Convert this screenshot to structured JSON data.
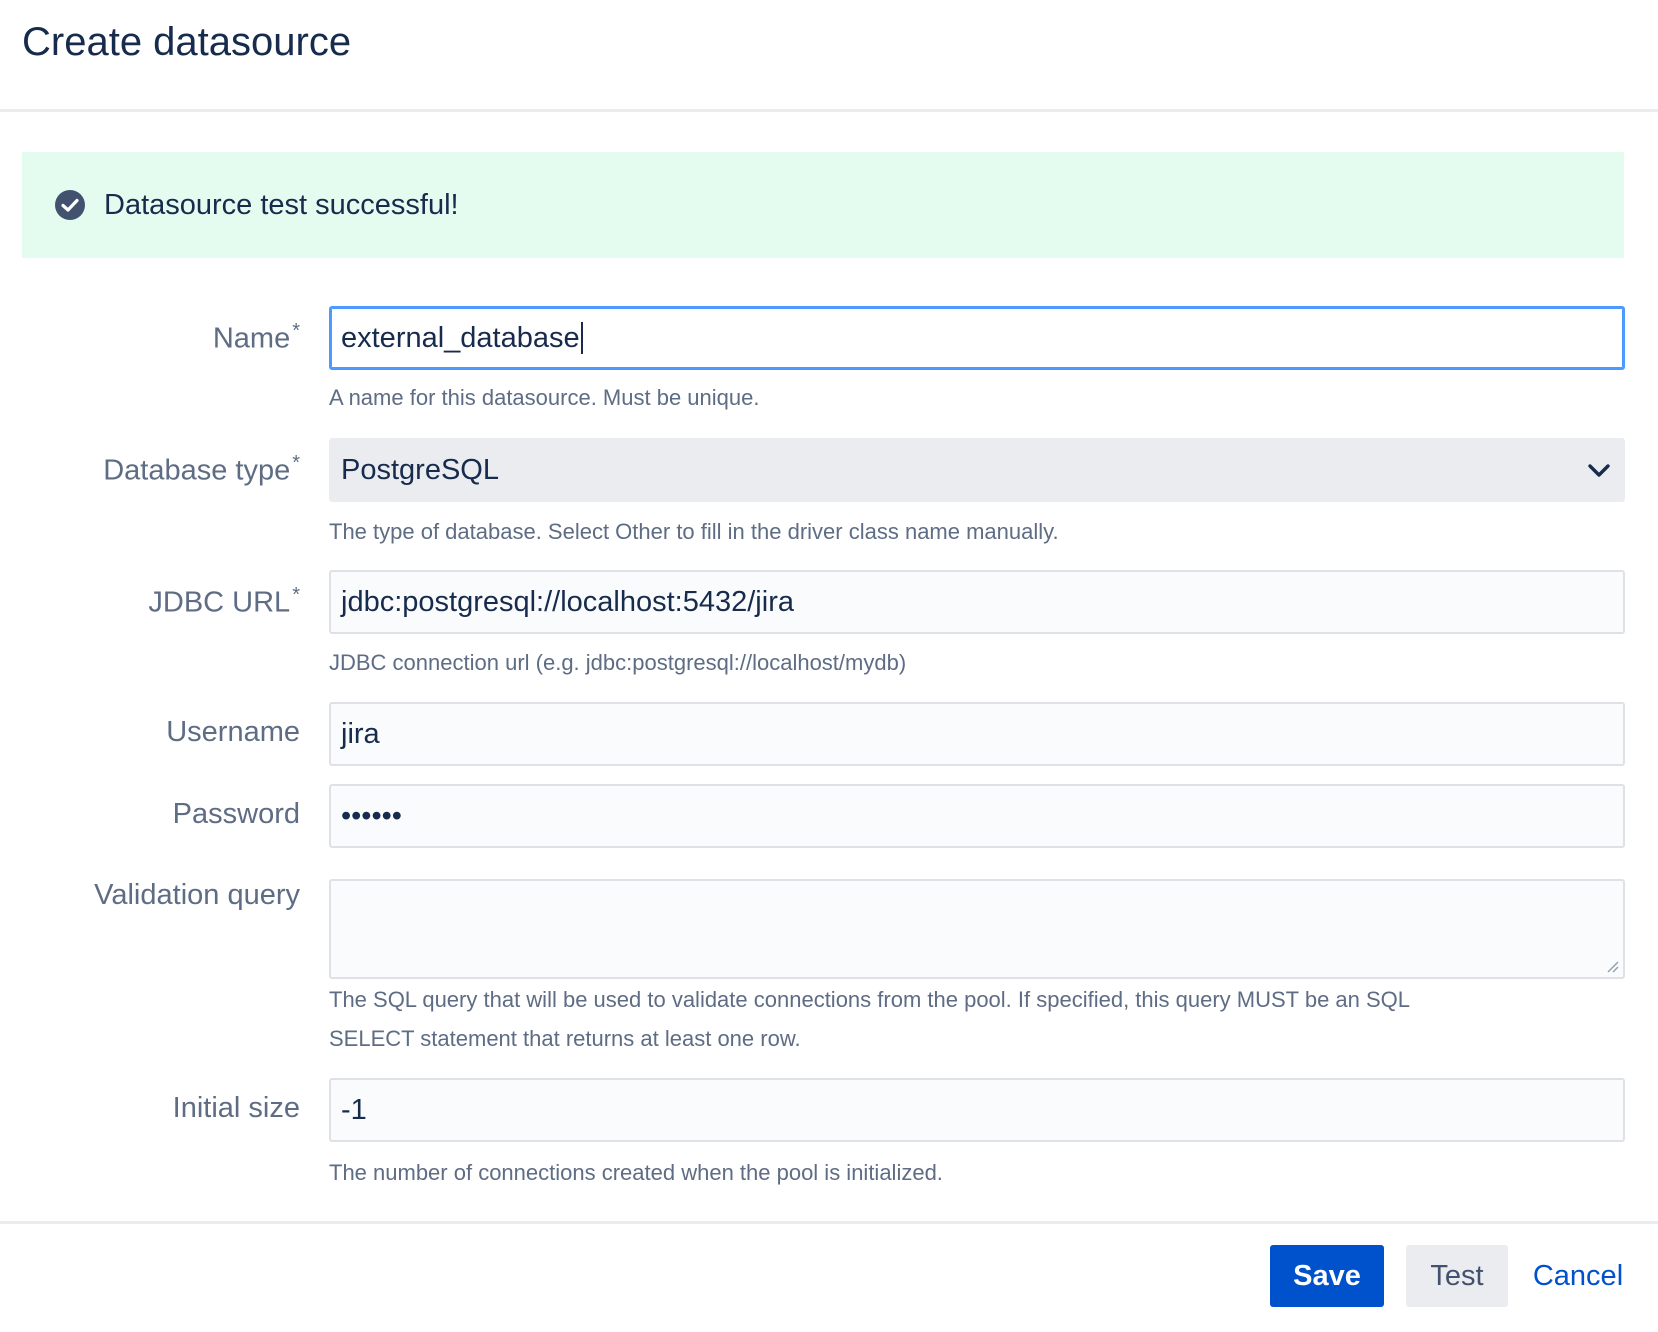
{
  "page": {
    "title": "Create datasource"
  },
  "banner": {
    "message": "Datasource test successful!",
    "color": "#e3fcef"
  },
  "form": {
    "name": {
      "label": "Name",
      "required_mark": "*",
      "value": "external_database",
      "help": "A name for this datasource. Must be unique."
    },
    "database_type": {
      "label": "Database type",
      "required_mark": "*",
      "value": "PostgreSQL",
      "help": "The type of database. Select Other to fill in the driver class name manually."
    },
    "jdbc_url": {
      "label": "JDBC URL",
      "required_mark": "*",
      "value": "jdbc:postgresql://localhost:5432/jira",
      "help": "JDBC connection url (e.g. jdbc:postgresql://localhost/mydb)"
    },
    "username": {
      "label": "Username",
      "value": "jira"
    },
    "password": {
      "label": "Password",
      "value": "••••••"
    },
    "validation_query": {
      "label": "Validation query",
      "value": "",
      "help_line1": "The SQL query that will be used to validate connections from the pool. If specified, this query MUST be an SQL",
      "help_line2": "SELECT statement that returns at least one row."
    },
    "initial_size": {
      "label": "Initial size",
      "value": "-1",
      "help": "The number of connections created when the pool is initialized."
    }
  },
  "buttons": {
    "save": "Save",
    "test": "Test",
    "cancel": "Cancel"
  },
  "colors": {
    "primary": "#0052cc",
    "focus": "#4c9aff",
    "success_bg": "#e3fcef"
  }
}
